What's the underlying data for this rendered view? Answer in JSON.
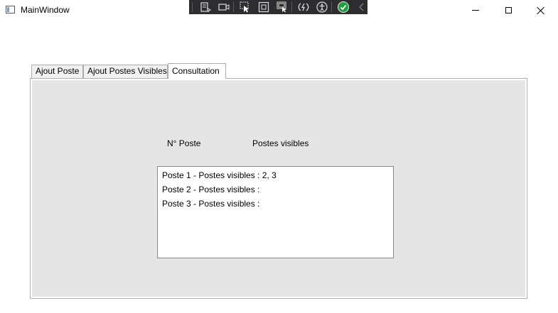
{
  "window": {
    "title": "MainWindow",
    "minimize_icon": "minimize-icon",
    "maximize_icon": "maximize-icon",
    "close_icon": "close-icon"
  },
  "debug_toolbar": {
    "icons": [
      "go-to-live-visual-tree-icon",
      "video-icon",
      "select-element-icon",
      "display-layout-adorners-icon",
      "track-focused-element-icon",
      "hot-reload-icon",
      "accessibility-icon",
      "status-check-icon",
      "collapse-arrow-icon"
    ]
  },
  "tabs": [
    {
      "label": "Ajout Poste",
      "selected": false
    },
    {
      "label": "Ajout Postes Visibles",
      "selected": false
    },
    {
      "label": "Consultation",
      "selected": true
    }
  ],
  "consultation": {
    "label_num_poste": "N° Poste",
    "label_postes_visibles": "Postes visibles",
    "list_items": [
      "Poste 1 - Postes visibles : 2, 3",
      "Poste 2 - Postes visibles :",
      "Poste 3 - Postes visibles :"
    ]
  },
  "colors": {
    "panel_background": "#e5e5e5",
    "toolbar_background": "#2d2d30",
    "check_green": "#1e9e3c"
  }
}
